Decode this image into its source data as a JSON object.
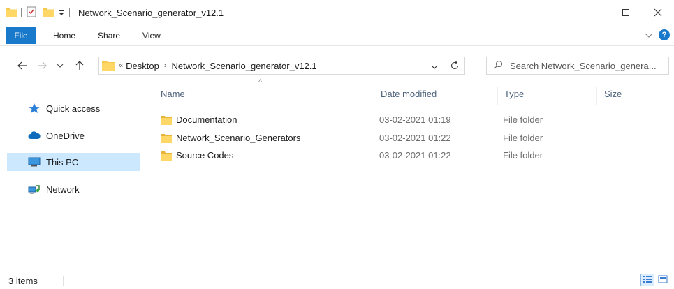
{
  "window": {
    "title": "Network_Scenario_generator_v12.1",
    "controls": {
      "minimize": "—",
      "maximize": "☐",
      "close": "✕"
    }
  },
  "ribbon": {
    "tabs": [
      "File",
      "Home",
      "Share",
      "View"
    ],
    "help": "?",
    "expand": "⌄"
  },
  "nav": {
    "back": "←",
    "forward": "→",
    "recent": "⌄",
    "up": "↑",
    "address": {
      "overflow": "«",
      "crumbs": [
        "Desktop",
        "Network_Scenario_generator_v12.1"
      ],
      "separator": "›",
      "dropdown": "⌄",
      "refresh": "↻"
    },
    "search": {
      "placeholder": "Search Network_Scenario_genera..."
    }
  },
  "sidebar": {
    "items": [
      {
        "label": "Quick access",
        "icon": "star-icon"
      },
      {
        "label": "OneDrive",
        "icon": "cloud-icon"
      },
      {
        "label": "This PC",
        "icon": "monitor-icon",
        "selected": true
      },
      {
        "label": "Network",
        "icon": "network-icon"
      }
    ]
  },
  "columns": {
    "name": "Name",
    "date": "Date modified",
    "type": "Type",
    "size": "Size",
    "sort_indicator": "^"
  },
  "files": [
    {
      "name": "Documentation",
      "date": "03-02-2021 01:19",
      "type": "File folder"
    },
    {
      "name": "Network_Scenario_Generators",
      "date": "03-02-2021 01:22",
      "type": "File folder"
    },
    {
      "name": "Source Codes",
      "date": "03-02-2021 01:22",
      "type": "File folder"
    }
  ],
  "status": {
    "count": "3 items"
  },
  "colors": {
    "accent": "#1979ca",
    "folder": "#f6c94f",
    "selected": "#cce8ff"
  }
}
